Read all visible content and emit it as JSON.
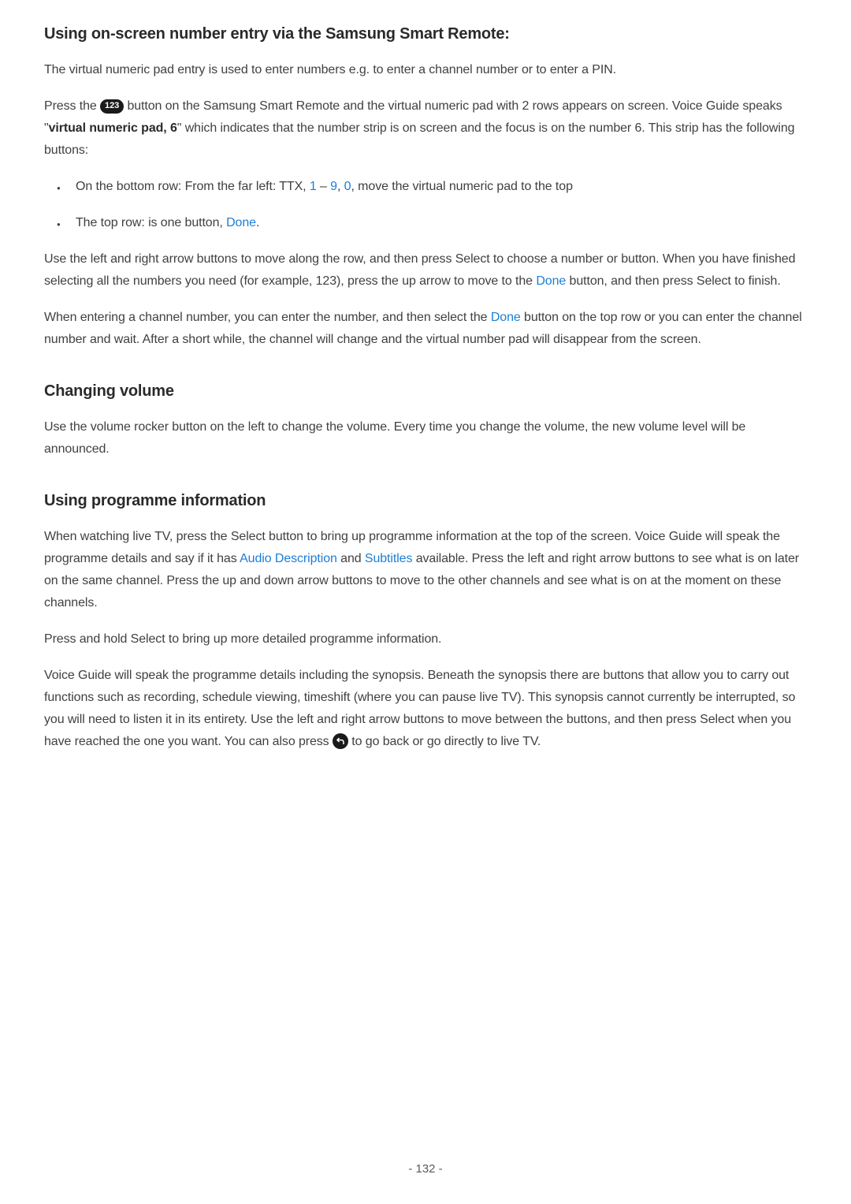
{
  "section1": {
    "heading": "Using on-screen number entry via the Samsung Smart Remote:",
    "p1": "The virtual numeric pad entry is used to enter numbers e.g. to enter a channel number or to enter a PIN.",
    "p2_a": "Press the ",
    "icon_123": "123",
    "p2_b": " button on the Samsung Smart Remote and the virtual numeric pad with 2 rows appears on screen. Voice Guide speaks \"",
    "p2_bold": "virtual numeric pad, 6",
    "p2_c": "\" which indicates that the number strip is on screen and the focus is on the number 6. This strip has the following buttons:",
    "li1_a": "On the bottom row: From the far left: TTX, ",
    "li1_link1": "1",
    "li1_dash": " – ",
    "li1_link2": "9",
    "li1_comma": ", ",
    "li1_link3": "0",
    "li1_b": ", move the virtual numeric pad to the top",
    "li2_a": "The top row: is one button, ",
    "li2_link": "Done",
    "li2_b": ".",
    "p3_a": "Use the left and right arrow buttons to move along the row, and then press Select to choose a number or button. When you have finished selecting all the numbers you need (for example, 123), press the up arrow to move to the ",
    "p3_link": "Done",
    "p3_b": " button, and then press Select to finish.",
    "p4_a": "When entering a channel number, you can enter the number, and then select the ",
    "p4_link": "Done",
    "p4_b": " button on the top row or you can enter the channel number and wait. After a short while, the channel will change and the virtual number pad will disappear from the screen."
  },
  "section2": {
    "heading": "Changing volume",
    "p1": "Use the volume rocker button on the left to change the volume. Every time you change the volume, the new volume level will be announced."
  },
  "section3": {
    "heading": "Using programme information",
    "p1_a": "When watching live TV, press the Select button to bring up programme information at the top of the screen. Voice Guide will speak the programme details and say if it has ",
    "p1_link1": "Audio Description",
    "p1_b": " and ",
    "p1_link2": "Subtitles",
    "p1_c": " available. Press the left and right arrow buttons to see what is on later on the same channel. Press the up and down arrow buttons to move to the other channels and see what is on at the moment on these channels.",
    "p2": "Press and hold Select to bring up more detailed programme information.",
    "p3_a": "Voice Guide will speak the programme details including the synopsis. Beneath the synopsis there are buttons that allow you to carry out functions such as recording, schedule viewing, timeshift (where you can pause live TV). This synopsis cannot currently be interrupted, so you will need to listen it in its entirety. Use the left and right arrow buttons to move between the buttons, and then press Select when you have reached the one you want. You can also press ",
    "p3_b": " to go back or go directly to live TV."
  },
  "page_number": "- 132 -"
}
